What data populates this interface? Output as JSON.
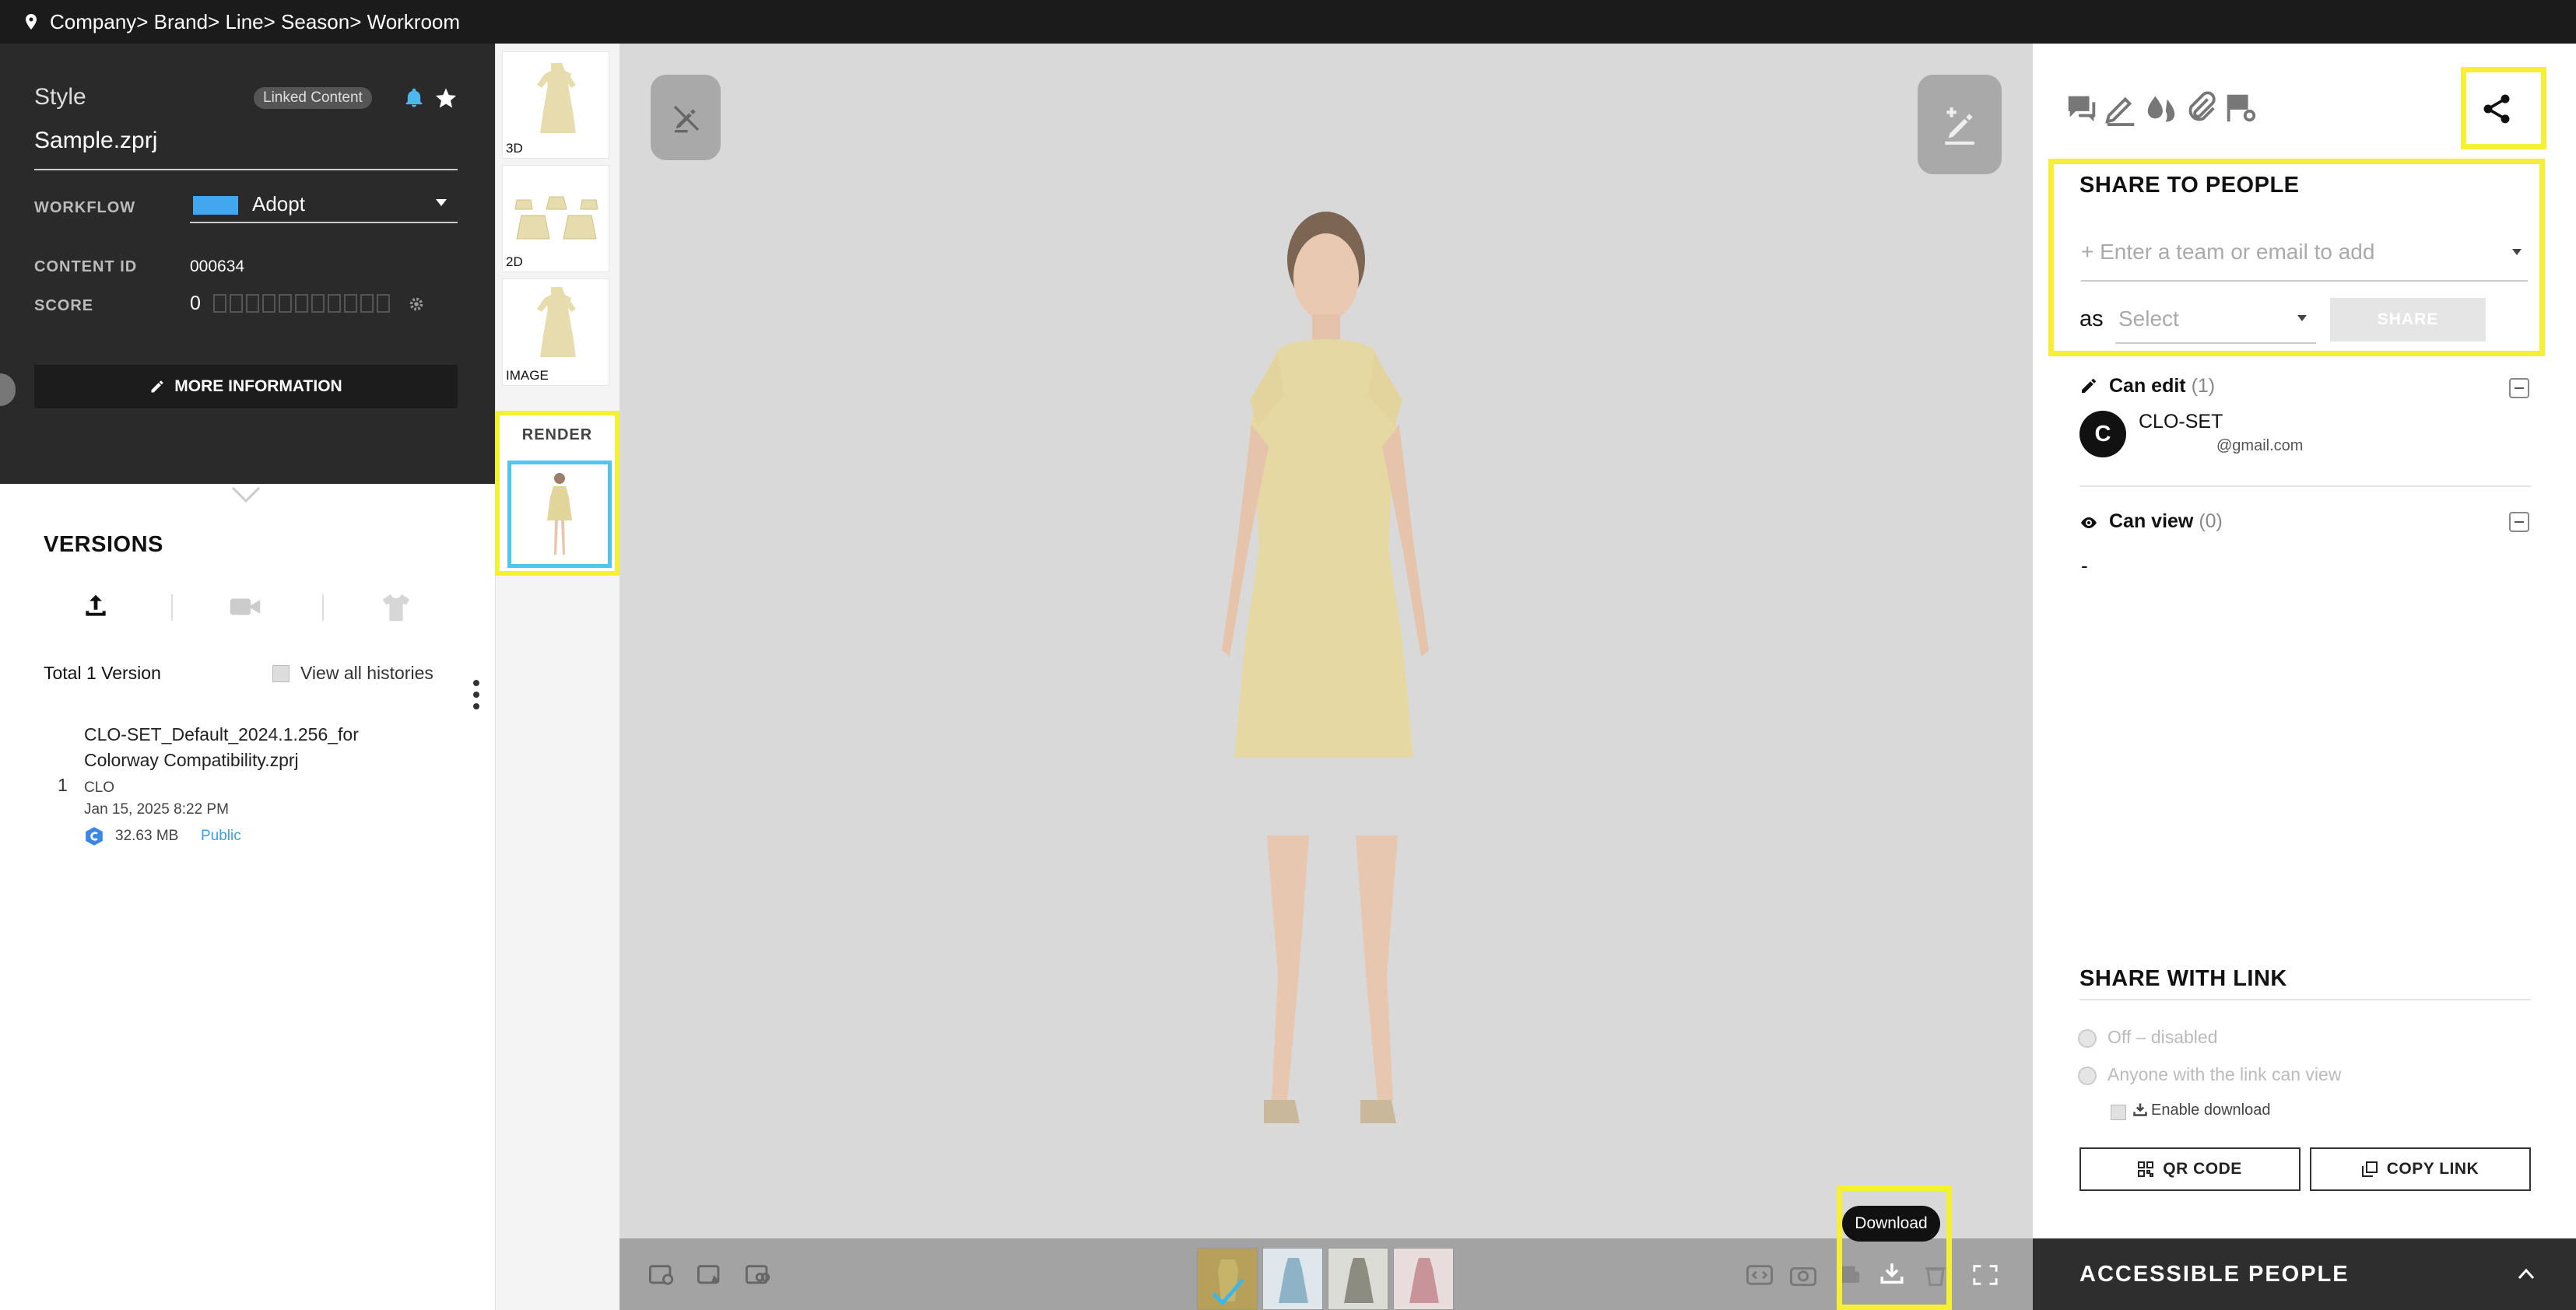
{
  "breadcrumb": {
    "path": "Company> Brand> Line> Season> Workroom"
  },
  "style_panel": {
    "title": "Style",
    "linked_badge": "Linked Content",
    "filename": "Sample.zprj",
    "workflow_label": "WORKFLOW",
    "workflow_value": "Adopt",
    "workflow_color": "#42a7ee",
    "content_id_label": "CONTENT ID",
    "content_id_value": "000634",
    "score_label": "SCORE",
    "score_value": "0",
    "more_info_label": "MORE INFORMATION"
  },
  "versions": {
    "title": "VERSIONS",
    "total_label": "Total 1 Version",
    "view_all_label": "View all histories",
    "items": [
      {
        "number": "1",
        "name": "CLO-SET_Default_2024.1.256_for Colorway Compatibility.zprj",
        "author": "CLO",
        "date": "Jan 15, 2025 8:22 PM",
        "size": "32.63 MB",
        "visibility": "Public"
      }
    ]
  },
  "thumbnails": {
    "items": [
      {
        "label": "3D"
      },
      {
        "label": "2D"
      },
      {
        "label": "IMAGE"
      }
    ],
    "render_label": "RENDER"
  },
  "viewer": {
    "download_tooltip": "Download",
    "colorways": [
      "#b7a15a",
      "#8fb3c6",
      "#8c8c80",
      "#c9939a"
    ]
  },
  "share_panel": {
    "share_to_people_title": "SHARE TO PEOPLE",
    "input_placeholder": "+ Enter a team or email to add",
    "as_label": "as",
    "select_placeholder": "Select",
    "share_button": "SHARE",
    "can_edit_label": "Can edit",
    "can_edit_count": "(1)",
    "members": [
      {
        "initial": "C",
        "name": "CLO-SET",
        "email": "@gmail.com"
      }
    ],
    "can_view_label": "Can view",
    "can_view_count": "(0)",
    "can_view_empty": "-",
    "share_with_link_title": "SHARE WITH LINK",
    "link_options": [
      "Off – disabled",
      "Anyone with the link can view"
    ],
    "enable_download_label": "Enable download",
    "qr_code_button": "QR CODE",
    "copy_link_button": "COPY LINK",
    "accessible_people_title": "ACCESSIBLE PEOPLE",
    "highlight_color": "#f5f034"
  }
}
